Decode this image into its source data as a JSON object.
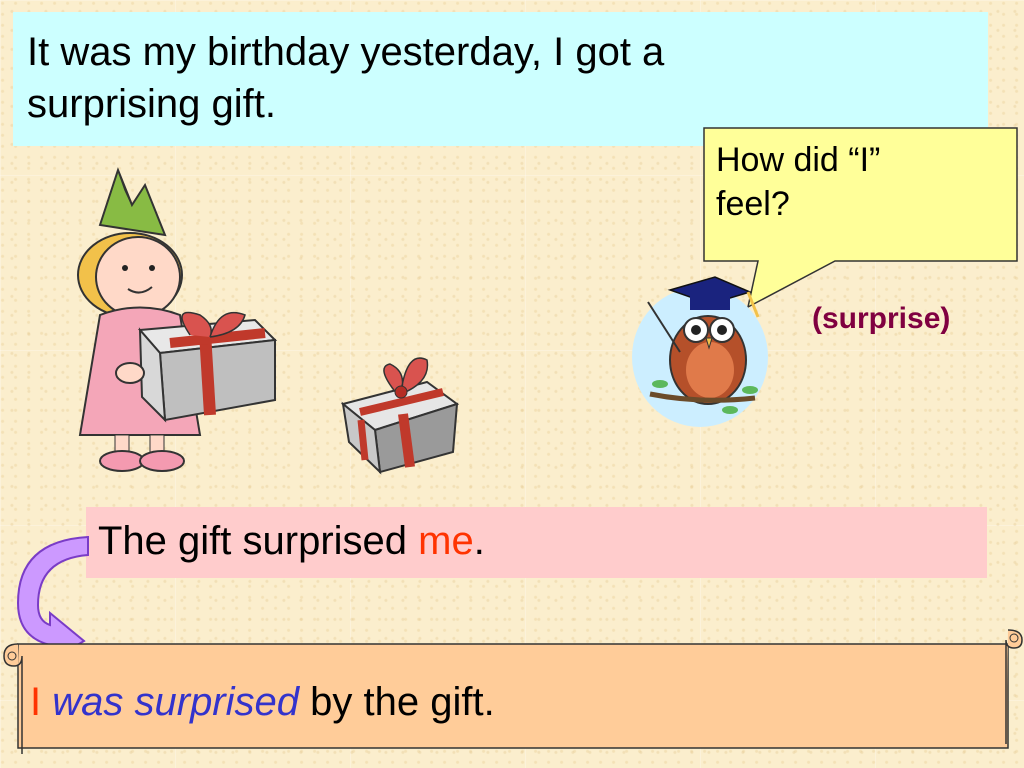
{
  "title": {
    "line1": "It was my birthday yesterday, I got a",
    "line2": "surprising gift."
  },
  "bubble": {
    "line1": "How did “I”",
    "line2": "feel?"
  },
  "hint": "(surprise)",
  "active_sentence": {
    "before": "The gift surprised ",
    "object": "me",
    "end": "."
  },
  "passive_sentence": {
    "subject": "I",
    "verb": "was surprised",
    "rest": " by the gift."
  },
  "colors": {
    "title_bg": "#ccffff",
    "sentence_bg": "#ffcccc",
    "scroll_bg": "#ffcc99",
    "bubble_bg": "#ffff99",
    "highlight_red": "#ff3300",
    "highlight_blue": "#3333cc",
    "hint_color": "#800040"
  },
  "icons": [
    "girl-with-gift-icon",
    "gift-box-icon",
    "owl-graduate-icon",
    "curved-arrow-icon"
  ]
}
